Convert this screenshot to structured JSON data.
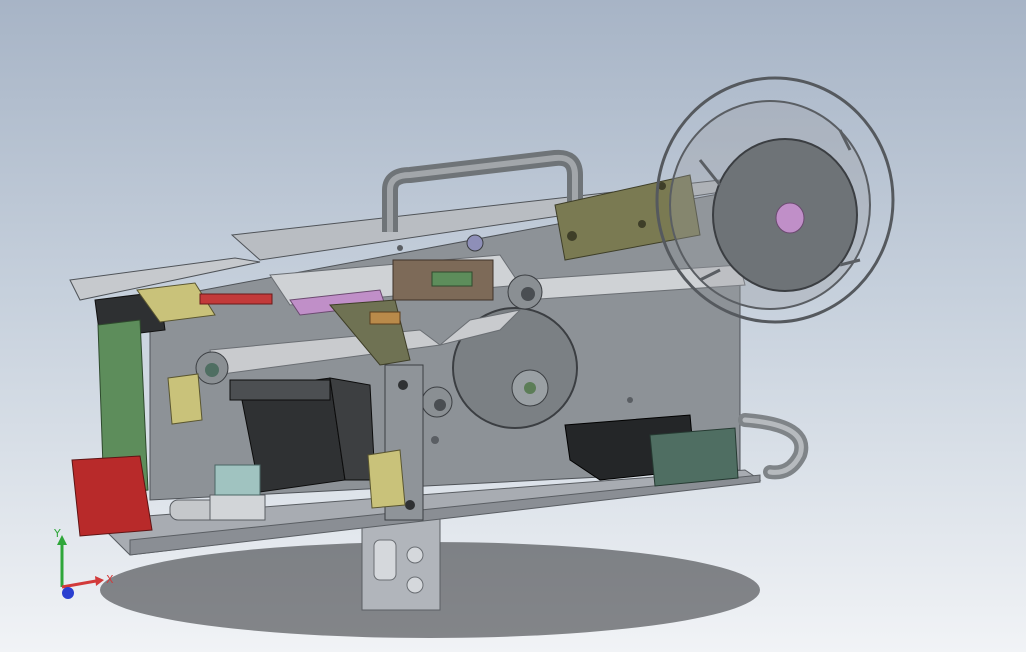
{
  "viewport": {
    "background_top": "#a7b4c6",
    "background_bottom": "#f1f3f6"
  },
  "model": {
    "colors": {
      "frame": "#8d9297",
      "base_plate": "#a8acb2",
      "handle": "#7c8185",
      "reel": "#6e7377",
      "roller": "#8a8f93",
      "motor": "#2f3133",
      "green_plate": "#5d8d5b",
      "red_block": "#b82a2a",
      "olive_bracket": "#7a7a52",
      "yellow_block": "#c9c27a",
      "pink_hub": "#c08fc8",
      "dark_box": "#242628",
      "teal_box": "#4f6e62"
    }
  },
  "triad": {
    "x_label": "X",
    "y_label": "Y",
    "x_color": "#d23a3a",
    "y_color": "#2fa63a",
    "z_color": "#2a3fd0"
  }
}
